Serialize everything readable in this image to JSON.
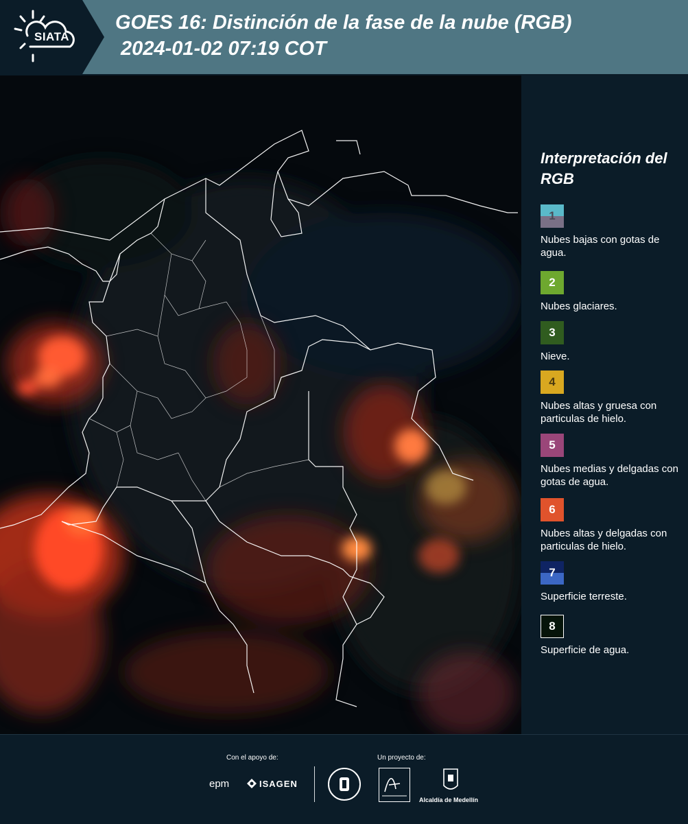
{
  "header": {
    "logo_text": "SIATA",
    "title": "GOES 16: Distinción de la fase de la nube (RGB)\n 2024-01-02 07:19 COT"
  },
  "legend": {
    "title": "Interpretación del RGB",
    "items": [
      {
        "number": "1",
        "label": "Nubes bajas con gotas de agua.",
        "color_top": "#5ab9c9",
        "color_bottom": "#7a7086"
      },
      {
        "number": "2",
        "label": "Nubes glaciares.",
        "color": "#6ea82f"
      },
      {
        "number": "3",
        "label": "Nieve.",
        "color": "#305c1f"
      },
      {
        "number": "4",
        "label": "Nubes altas y gruesa con particulas de hielo.",
        "color": "#d9a820"
      },
      {
        "number": "5",
        "label": "Nubes medias y delgadas con gotas de agua.",
        "color": "#9a4679"
      },
      {
        "number": "6",
        "label": "Nubes altas y delgadas con particulas de hielo.",
        "color": "#e0532c"
      },
      {
        "number": "7",
        "label": "Superficie terreste.",
        "color_top": "#0f2463",
        "color_bottom": "#3c67c4"
      },
      {
        "number": "8",
        "label": "Superficie de agua.",
        "color": "#06140a"
      }
    ]
  },
  "footer": {
    "support_label": "Con el apoyo de:",
    "project_label": "Un proyecto de:",
    "sponsors": [
      "epm",
      "ISAGEN"
    ],
    "partners": [
      "Area Metropolitana Valle de Aburrá",
      "Alcaldía de Medellín"
    ]
  },
  "map": {
    "description_layer": "satellite-rgb",
    "palette": {
      "background": "#05090d",
      "cloud_ice": "#e2401f",
      "cloud_thick": "#f07a3a",
      "border": "#ffffff"
    }
  }
}
